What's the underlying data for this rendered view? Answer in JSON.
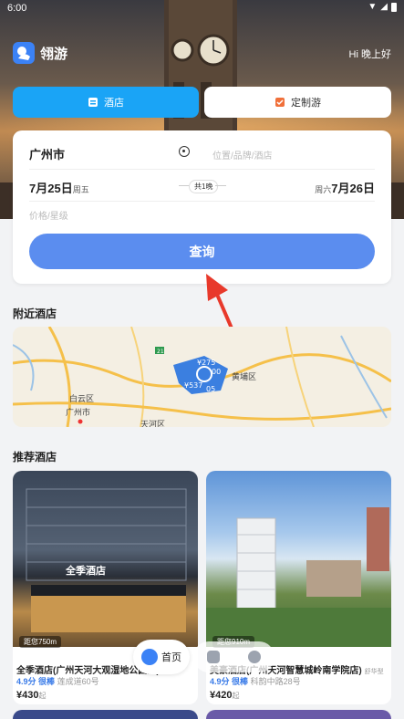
{
  "status": {
    "time": "6:00"
  },
  "app": {
    "name": "翎游",
    "greeting": "Hi 晚上好"
  },
  "tabs": [
    {
      "label": "酒店",
      "active": true
    },
    {
      "label": "定制游",
      "active": false
    }
  ],
  "search": {
    "city": "广州市",
    "location_placeholder": "位置/品牌/酒店",
    "checkin_date": "7月25日",
    "checkin_weekday": "周五",
    "nights": "共1晚",
    "checkout_weekday": "周六",
    "checkout_date": "7月26日",
    "price_placeholder": "价格/星级",
    "button": "查询"
  },
  "nearby": {
    "title": "附近酒店",
    "map_labels": [
      "白云区",
      "广州市",
      "黄埔区",
      "天河区"
    ],
    "price_markers": [
      "¥275",
      "¥537",
      "00",
      "05"
    ],
    "route_number": "21"
  },
  "recommended": {
    "title": "推荐酒店",
    "hotels": [
      {
        "name": "全季酒店(广州天河大观湿地公园店)",
        "score": "4.9分",
        "rating": "很棒",
        "address": "莲成道60号",
        "price": "¥430",
        "price_unit": "起",
        "distance": "距您750m",
        "sign": "全季酒店"
      },
      {
        "name": "美豪酒店(广州天河智慧城岭南学院店)",
        "tag": "舒华型",
        "score": "4.9分",
        "rating": "很棒",
        "address": "科韵中路28号",
        "price": "¥420",
        "price_unit": "起",
        "distance": "距您910m"
      }
    ]
  },
  "bottom_nav": {
    "home": "首页"
  },
  "colors": {
    "accent": "#5b8def",
    "tab_active": "#1aa4f6",
    "score": "#3a7be8"
  }
}
